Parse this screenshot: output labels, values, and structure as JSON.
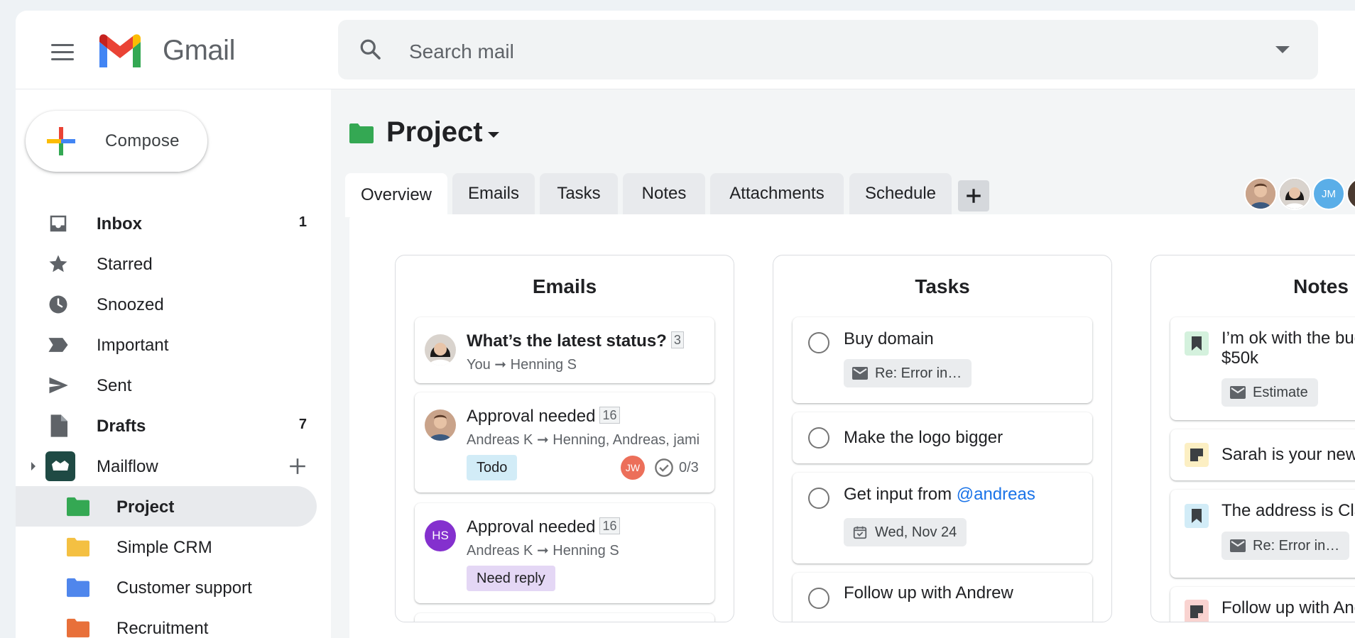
{
  "header": {
    "brand": "Gmail",
    "search_placeholder": "Search mail"
  },
  "sidebar": {
    "compose_label": "Compose",
    "items": [
      {
        "label": "Inbox",
        "count": "1"
      },
      {
        "label": "Starred",
        "count": ""
      },
      {
        "label": "Snoozed",
        "count": ""
      },
      {
        "label": "Important",
        "count": ""
      },
      {
        "label": "Sent",
        "count": ""
      },
      {
        "label": "Drafts",
        "count": "7"
      },
      {
        "label": "Mailflow",
        "count": ""
      }
    ],
    "folders": [
      {
        "label": "Project",
        "color": "#34a853"
      },
      {
        "label": "Simple CRM",
        "color": "#f4c042"
      },
      {
        "label": "Customer support",
        "color": "#4f86ec"
      },
      {
        "label": "Recruitment",
        "color": "#e8703a"
      }
    ]
  },
  "project": {
    "title": "Project",
    "tabs": [
      "Overview",
      "Emails",
      "Tasks",
      "Notes",
      "Attachments",
      "Schedule"
    ],
    "member_initials": "JM"
  },
  "columns": {
    "emails": {
      "title": "Emails",
      "items": [
        {
          "subject": "What’s the latest status?",
          "count": "3",
          "meta": "You ➞ Henning S"
        },
        {
          "subject": "Approval needed",
          "count": "16",
          "meta": "Andreas K ➞ Henning, Andreas, jami",
          "label": "Todo",
          "assignee": "JW",
          "progress": "0/3"
        },
        {
          "subject": "Approval needed",
          "count": "16",
          "meta": "Andreas K ➞ Henning S",
          "label": "Need reply",
          "avatar_initials": "HS"
        }
      ]
    },
    "tasks": {
      "title": "Tasks",
      "items": [
        {
          "text": "Buy domain",
          "chip": "Re: Error in…"
        },
        {
          "text": "Make the logo bigger"
        },
        {
          "text": "Get input from ",
          "mention": "@andreas",
          "chip": "Wed, Nov 24"
        },
        {
          "text": "Follow up with Andrew"
        }
      ]
    },
    "notes": {
      "title": "Notes",
      "items": [
        {
          "text_line1": "I’m ok with the bud",
          "text_line2": "$50k",
          "chip": "Estimate"
        },
        {
          "text_line1": "Sarah is your new c"
        },
        {
          "text_line1": "The address is Cla",
          "chip": "Re: Error in…"
        },
        {
          "text_line1": "Follow up with And"
        }
      ]
    }
  }
}
